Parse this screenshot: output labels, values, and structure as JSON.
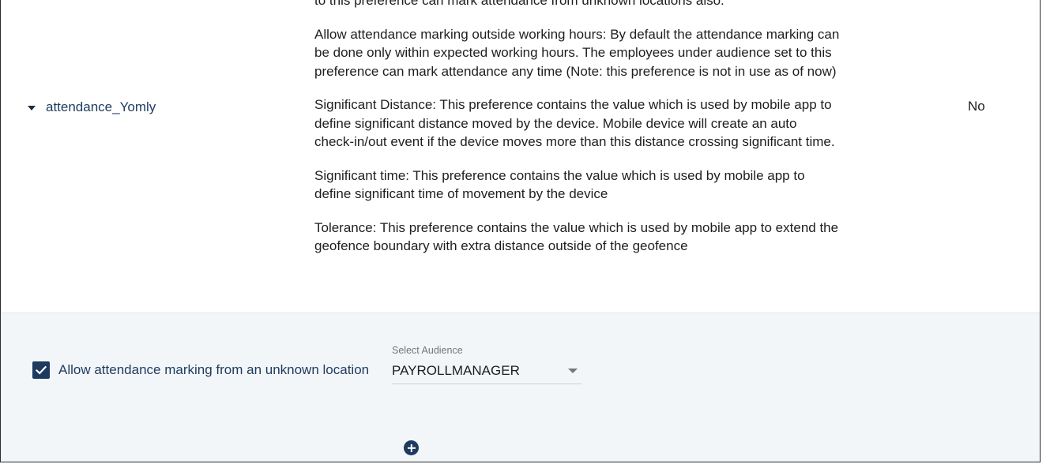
{
  "preference_row": {
    "title": "attendance_Yomly",
    "value": "No",
    "descriptions": [
      "to this preference can mark attendance from unknown locations also.",
      "Allow attendance marking outside working hours: By default the attendance marking can be done only within expected working hours. The employees under audience set to this preference can mark attendance any time (Note: this preference is not in use as of now)",
      "Significant Distance: This preference contains the value which is used by mobile app to define significant distance moved by the device. Mobile device will create an auto check-in/out event if the device moves more than this distance crossing significant time.",
      "Significant time: This preference contains the value which is used by mobile app to define significant time of movement by the device",
      "Tolerance: This preference contains the value which is used by mobile app to extend the geofence boundary with extra distance outside of the geofence"
    ]
  },
  "settings": {
    "checkbox_label": "Allow attendance marking from an unknown location",
    "checkbox_checked": true,
    "audience_caption": "Select Audience",
    "audience_value": "PAYROLLMANAGER"
  },
  "icons": {
    "expand": "caret-down-icon",
    "check": "checkmark-icon",
    "dropdown": "dropdown-arrow-icon",
    "add": "add-circle-icon"
  },
  "colors": {
    "accent": "#1d3a5f",
    "panel_bg": "#f3f6f8"
  }
}
